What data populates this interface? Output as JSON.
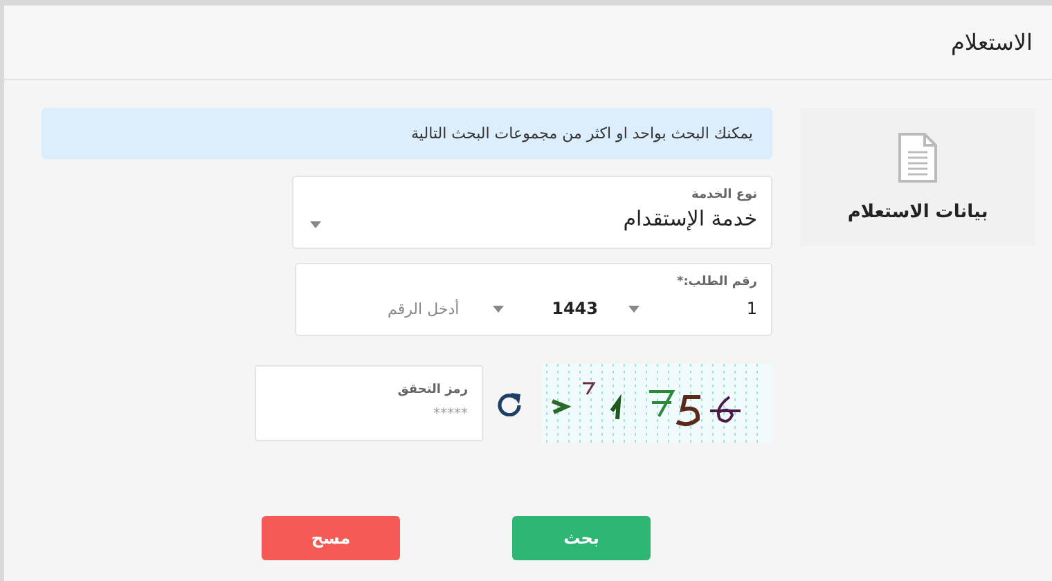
{
  "header": {
    "title": "الاستعلام"
  },
  "sidebar": {
    "items": [
      {
        "label": "بيانات الاستعلام"
      }
    ]
  },
  "notice": "يمكنك البحث بواحد او اكثر من مجموعات البحث التالية",
  "service": {
    "label": "نوع الخدمة",
    "value": "خدمة الإستقدام"
  },
  "request_number": {
    "label": "رقم الطلب:*",
    "parts": [
      {
        "kind": "select",
        "value": "1"
      },
      {
        "kind": "select",
        "value": "1443"
      },
      {
        "kind": "input",
        "placeholder": "أدخل الرقم"
      }
    ]
  },
  "captcha": {
    "label": "رمز التحقق",
    "placeholder": "*****"
  },
  "buttons": [
    {
      "label": "بحث",
      "kind": "primary"
    },
    {
      "label": "مسح",
      "kind": "danger"
    }
  ]
}
